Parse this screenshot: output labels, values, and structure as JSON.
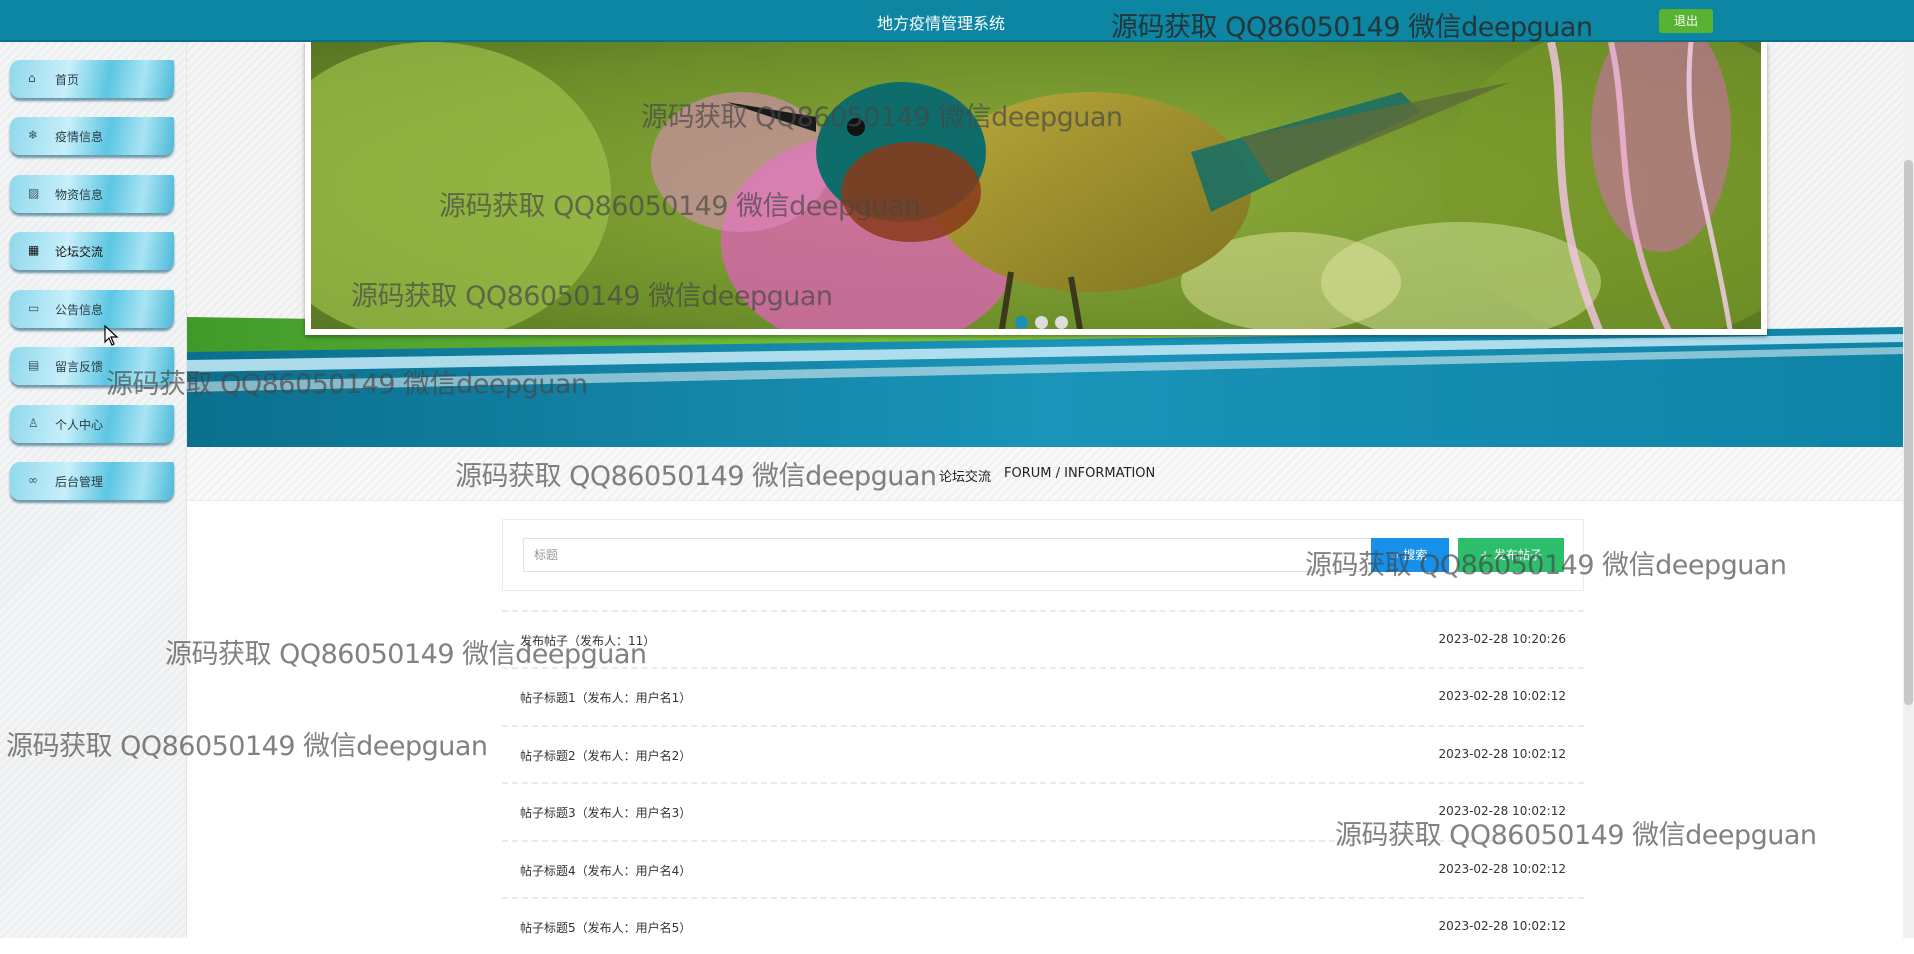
{
  "header": {
    "title": "地方疫情管理系统",
    "logout_label": "退出"
  },
  "sidebar": {
    "items": [
      {
        "icon": "home-icon",
        "glyph": "⌂",
        "label": "首页"
      },
      {
        "icon": "snowflake-icon",
        "glyph": "❄",
        "label": "疫情信息"
      },
      {
        "icon": "image-icon",
        "glyph": "▨",
        "label": "物资信息"
      },
      {
        "icon": "grid-icon",
        "glyph": "▦",
        "label": "论坛交流"
      },
      {
        "icon": "book-icon",
        "glyph": "▭",
        "label": "公告信息"
      },
      {
        "icon": "calendar-icon",
        "glyph": "▤",
        "label": "留言反馈"
      },
      {
        "icon": "user-icon",
        "glyph": "♙",
        "label": "个人中心"
      },
      {
        "icon": "link-icon",
        "glyph": "∞",
        "label": "后台管理"
      }
    ],
    "active_index": 3
  },
  "carousel": {
    "slides": 3,
    "active": 0
  },
  "section": {
    "title_zh": "论坛交流",
    "title_en": "FORUM / INFORMATION"
  },
  "search": {
    "placeholder": "标题",
    "search_label": "搜索",
    "publish_label": "发布帖子"
  },
  "posts": [
    {
      "title": "发布帖子（发布人：11）",
      "time": "2023-02-28 10:20:26"
    },
    {
      "title": "帖子标题1（发布人：用户名1）",
      "time": "2023-02-28 10:02:12"
    },
    {
      "title": "帖子标题2（发布人：用户名2）",
      "time": "2023-02-28 10:02:12"
    },
    {
      "title": "帖子标题3（发布人：用户名3）",
      "time": "2023-02-28 10:02:12"
    },
    {
      "title": "帖子标题4（发布人：用户名4）",
      "time": "2023-02-28 10:02:12"
    },
    {
      "title": "帖子标题5（发布人：用户名5）",
      "time": "2023-02-28 10:02:12"
    }
  ],
  "watermark": "源码获取 QQ86050149 微信deepguan",
  "colors": {
    "topbar": "#0c86a3",
    "logout": "#59b333",
    "search": "#1690e8",
    "publish": "#2dbe6c",
    "dot_active": "#1a8fb5"
  }
}
